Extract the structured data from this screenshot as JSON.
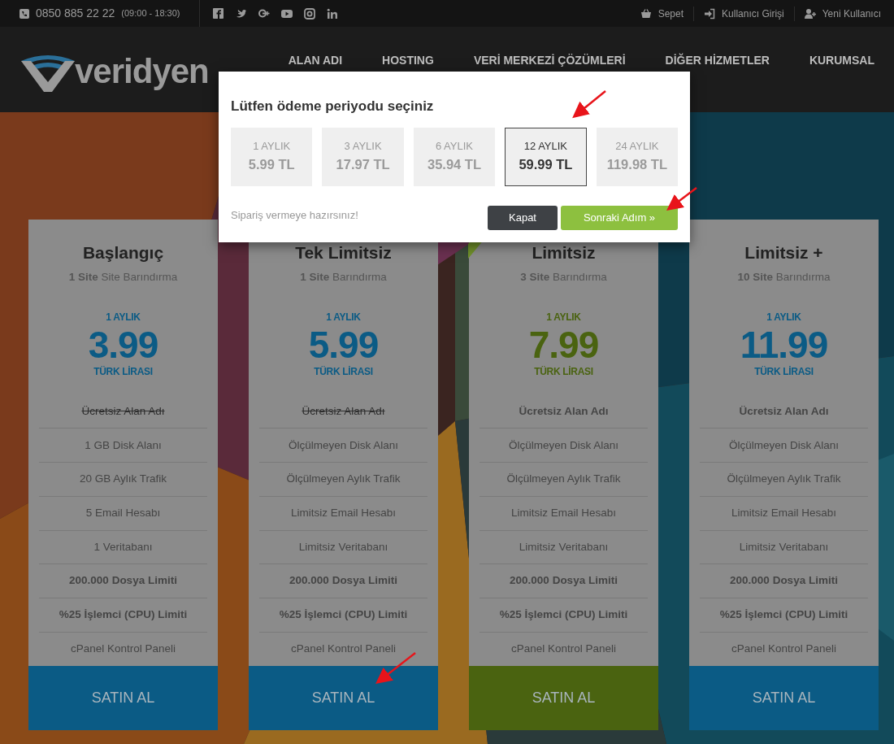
{
  "top_bar": {
    "phone": "0850 885 22 22",
    "hours": "(09:00 - 18:30)",
    "links": [
      {
        "kind": "basket",
        "label": "Sepet"
      },
      {
        "kind": "login",
        "label": "Kullanıcı Girişi"
      },
      {
        "kind": "register",
        "label": "Yeni Kullanıcı"
      }
    ]
  },
  "header": {
    "logo": "veridyen",
    "nav": [
      "ALAN ADI",
      "HOSTING",
      "VERİ MERKEZİ ÇÖZÜMLERİ",
      "DİĞER HİZMETLER",
      "KURUMSAL"
    ]
  },
  "plans": [
    {
      "title": "Başlangıç",
      "subtitle": "**1 Site** Site Barındırma",
      "period": "1 AYLIK",
      "price": "3.99",
      "currency": "TÜRK LİRASI",
      "color": "#0b5b85",
      "ribbon": false,
      "features": [
        {
          "text": "Ücretsiz Alan Adı",
          "bold": false,
          "excluded": true
        },
        {
          "text": "1 GB Disk Alanı",
          "bold": false,
          "excluded": false
        },
        {
          "text": "20 GB Aylık Trafik",
          "bold": false,
          "excluded": false
        },
        {
          "text": "5 Email Hesabı",
          "bold": false,
          "excluded": false
        },
        {
          "text": "1 Veritabanı",
          "bold": false,
          "excluded": false
        },
        {
          "text": "200.000 Dosya Limiti",
          "bold": true,
          "excluded": false
        },
        {
          "text": "%25 İşlemci (CPU) Limiti",
          "bold": true,
          "excluded": false
        },
        {
          "text": "cPanel Kontrol Paneli",
          "bold": false,
          "excluded": false
        }
      ],
      "button": "SATIN AL"
    },
    {
      "title": "Tek Limitsiz",
      "subtitle": "**1 Site** Barındırma",
      "period": "1 AYLIK",
      "price": "5.99",
      "currency": "TÜRK LİRASI",
      "color": "#0b5b85",
      "ribbon": false,
      "features": [
        {
          "text": "Ücretsiz Alan Adı",
          "bold": false,
          "excluded": true
        },
        {
          "text": "Ölçülmeyen Disk Alanı",
          "bold": false,
          "excluded": false
        },
        {
          "text": "Ölçülmeyen Aylık Trafik",
          "bold": false,
          "excluded": false
        },
        {
          "text": "Limitsiz Email Hesabı",
          "bold": false,
          "excluded": false
        },
        {
          "text": "Limitsiz Veritabanı",
          "bold": false,
          "excluded": false
        },
        {
          "text": "200.000 Dosya Limiti",
          "bold": true,
          "excluded": false
        },
        {
          "text": "%25 İşlemci (CPU) Limiti",
          "bold": true,
          "excluded": false
        },
        {
          "text": "cPanel Kontrol Paneli",
          "bold": false,
          "excluded": false
        }
      ],
      "button": "SATIN AL"
    },
    {
      "title": "Limitsiz",
      "subtitle": "**3 Site** Barındırma",
      "period": "1 AYLIK",
      "price": "7.99",
      "currency": "TÜRK LİRASI",
      "color": "#4a6310",
      "ribbon": true,
      "features": [
        {
          "text": "Ücretsiz Alan Adı",
          "bold": true,
          "excluded": false
        },
        {
          "text": "Ölçülmeyen Disk Alanı",
          "bold": false,
          "excluded": false
        },
        {
          "text": "Ölçülmeyen Aylık Trafik",
          "bold": false,
          "excluded": false
        },
        {
          "text": "Limitsiz Email Hesabı",
          "bold": false,
          "excluded": false
        },
        {
          "text": "Limitsiz Veritabanı",
          "bold": false,
          "excluded": false
        },
        {
          "text": "200.000 Dosya Limiti",
          "bold": true,
          "excluded": false
        },
        {
          "text": "%25 İşlemci (CPU) Limiti",
          "bold": true,
          "excluded": false
        },
        {
          "text": "cPanel Kontrol Paneli",
          "bold": false,
          "excluded": false
        }
      ],
      "button": "SATIN AL"
    },
    {
      "title": "Limitsiz +",
      "subtitle": "**10 Site** Barındırma",
      "period": "1 AYLIK",
      "price": "11.99",
      "currency": "TÜRK LİRASI",
      "color": "#0b5b85",
      "ribbon": false,
      "features": [
        {
          "text": "Ücretsiz Alan Adı",
          "bold": true,
          "excluded": false
        },
        {
          "text": "Ölçülmeyen Disk Alanı",
          "bold": false,
          "excluded": false
        },
        {
          "text": "Ölçülmeyen Aylık Trafik",
          "bold": false,
          "excluded": false
        },
        {
          "text": "Limitsiz Email Hesabı",
          "bold": false,
          "excluded": false
        },
        {
          "text": "Limitsiz Veritabanı",
          "bold": false,
          "excluded": false
        },
        {
          "text": "200.000 Dosya Limiti",
          "bold": true,
          "excluded": false
        },
        {
          "text": "%25 İşlemci (CPU) Limiti",
          "bold": true,
          "excluded": false
        },
        {
          "text": "cPanel Kontrol Paneli",
          "bold": false,
          "excluded": false
        }
      ],
      "button": "SATIN AL"
    }
  ],
  "modal": {
    "title": "Lütfen ödeme periyodu seçiniz",
    "periods": [
      {
        "label": "1 AYLIK",
        "price": "5.99 TL",
        "selected": false
      },
      {
        "label": "3 AYLIK",
        "price": "17.97 TL",
        "selected": false
      },
      {
        "label": "6 AYLIK",
        "price": "35.94 TL",
        "selected": false
      },
      {
        "label": "12 AYLIK",
        "price": "59.99 TL",
        "selected": true
      },
      {
        "label": "24 AYLIK",
        "price": "119.98 TL",
        "selected": false
      }
    ],
    "message": "Sipariş vermeye hazırsınız!",
    "close_button": "Kapat",
    "next_button": "Sonraki Adım »"
  }
}
